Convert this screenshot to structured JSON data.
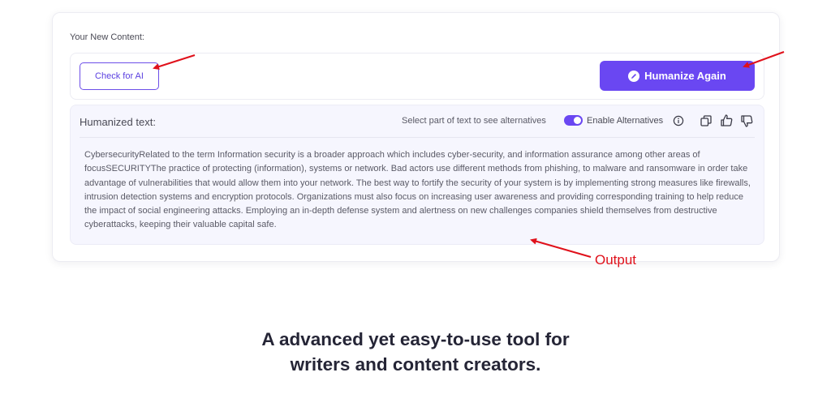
{
  "card": {
    "label": "Your New Content:",
    "check_button": "Check for AI",
    "humanize_button": "Humanize Again"
  },
  "output": {
    "title": "Humanized text:",
    "hint": "Select part of text to see alternatives",
    "toggle_label": "Enable Alternatives",
    "toggle_on": true,
    "body": "CybersecurityRelated to the term Information security is a broader approach which includes cyber-security, and information assurance among other areas of focusSECURITYThe practice of protecting (information), systems or network. Bad actors use different methods from phishing, to malware and ransomware in order take advantage of vulnerabilities that would allow them into your network. The best way to fortify the security of your system is by implementing strong measures like firewalls, intrusion detection systems and encryption protocols. Organizations must also focus on increasing user awareness and providing corresponding training to help reduce the impact of social engineering attacks. Employing an in-depth defense system and alertness on new challenges companies shield themselves from destructive cyberattacks, keeping their valuable capital safe."
  },
  "annotations": {
    "output_label": "Output",
    "color": "#e0111b"
  },
  "tagline": {
    "line1": "A advanced yet easy-to-use tool for",
    "line2": "writers and content creators."
  },
  "icons": {
    "humanize": "edit-pen-icon",
    "info": "info-icon",
    "copy": "copy-icon",
    "like": "thumbs-up-icon",
    "dislike": "thumbs-down-icon"
  },
  "colors": {
    "accent": "#6a47f2",
    "panel_bg": "#f6f6fe",
    "tagline": "#252536"
  }
}
